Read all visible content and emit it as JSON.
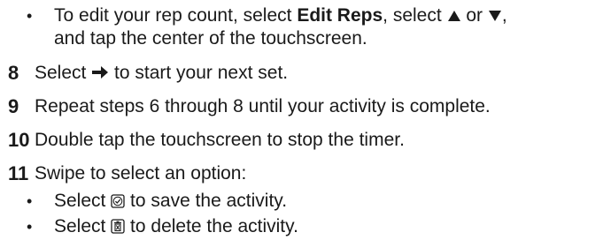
{
  "bullets_top": {
    "line1_pre": "To edit your rep count, select ",
    "line1_bold": "Edit Reps",
    "line1_mid": ", select ",
    "line1_or": " or ",
    "line1_end": ",",
    "line2": "and tap the center of the touchscreen."
  },
  "steps": [
    {
      "number": "8",
      "pre": "Select ",
      "post": " to start your next set."
    },
    {
      "number": "9",
      "text": "Repeat steps 6 through 8 until your activity is complete."
    },
    {
      "number": "10",
      "text": "Double tap the touchscreen to stop the timer."
    },
    {
      "number": "11",
      "text": "Swipe to select an option:"
    }
  ],
  "options": [
    {
      "pre": "Select ",
      "post": " to save the activity.",
      "icon": "check-box-icon"
    },
    {
      "pre": "Select ",
      "post": " to delete the activity.",
      "icon": "trash-icon"
    }
  ],
  "bullet_char": "•"
}
